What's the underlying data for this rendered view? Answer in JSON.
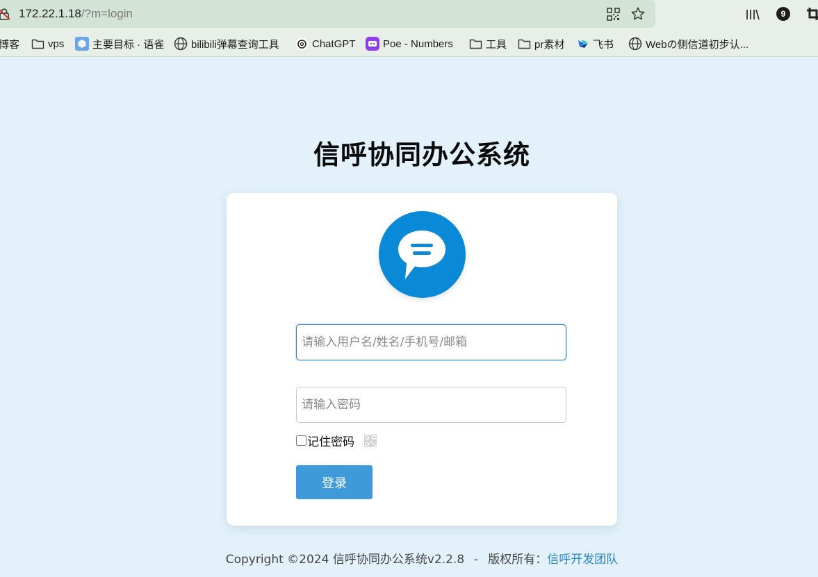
{
  "browser": {
    "url_host": "172.22.1.18",
    "url_path": "/?m=login",
    "badge_count": "9",
    "bookmarks": [
      {
        "label": "博客",
        "icon": "folder-icon"
      },
      {
        "label": "vps",
        "icon": "folder-icon"
      },
      {
        "label": "主要目标 · 语雀",
        "icon": "yuque-icon"
      },
      {
        "label": "bilibili弹幕查询工具",
        "icon": "globe-icon"
      },
      {
        "label": "ChatGPT",
        "icon": "chatgpt-icon"
      },
      {
        "label": "Poe - Numbers",
        "icon": "poe-icon"
      },
      {
        "label": "工具",
        "icon": "folder-icon"
      },
      {
        "label": "pr素材",
        "icon": "folder-icon"
      },
      {
        "label": "飞书",
        "icon": "feishu-icon"
      },
      {
        "label": "Webの侧信道初步认...",
        "icon": "globe-icon"
      }
    ]
  },
  "login": {
    "title": "信呼协同办公系统",
    "username_placeholder": "请输入用户名/姓名/手机号/邮箱",
    "password_placeholder": "请输入密码",
    "remember_label": "记住密码",
    "submit_label": "登录"
  },
  "footer": {
    "copyright": "Copyright ©2024 信呼协同办公系统v2.2.8",
    "separator": "-",
    "rights_label": "版权所有：",
    "team_link": "信呼开发团队"
  },
  "colors": {
    "page_background": "#e3f2fa",
    "logo_blue": "#0a8ad6",
    "button_blue": "#3e9ad8",
    "link_blue": "#2a86c8"
  }
}
